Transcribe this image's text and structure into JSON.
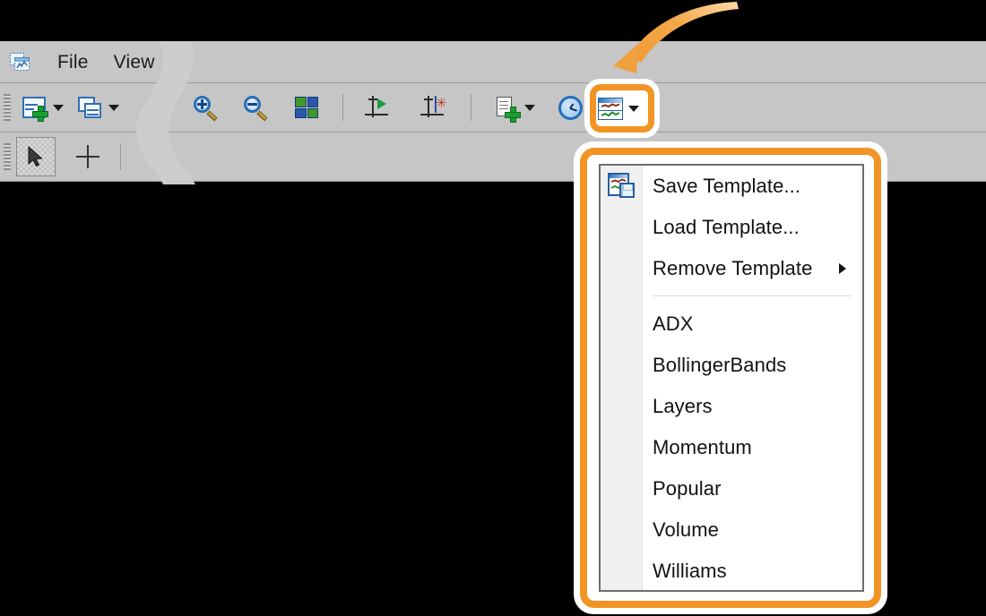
{
  "app": {
    "icon": "chart-window-icon",
    "menubar": [
      {
        "label": "File",
        "name": "menu-file"
      },
      {
        "label": "View",
        "name": "menu-view"
      }
    ]
  },
  "toolbar_row1": {
    "buttons": [
      {
        "name": "add-chart-button",
        "icon": "add-chart-icon",
        "has_dropdown": true
      },
      {
        "name": "arrange-charts-button",
        "icon": "arrange-charts-icon",
        "has_dropdown": true
      },
      {
        "name": "zoom-in-button",
        "icon": "zoom-in-icon",
        "has_dropdown": false
      },
      {
        "name": "zoom-out-button",
        "icon": "zoom-out-icon",
        "has_dropdown": false
      },
      {
        "name": "tile-windows-button",
        "icon": "tile-windows-icon",
        "has_dropdown": false
      },
      {
        "name": "axis-forward-button",
        "icon": "axis-play-icon",
        "has_dropdown": false
      },
      {
        "name": "axis-marker-button",
        "icon": "axis-marker-icon",
        "has_dropdown": false
      },
      {
        "name": "add-document-button",
        "icon": "document-plus-icon",
        "has_dropdown": true
      },
      {
        "name": "time-interval-button",
        "icon": "clock-icon",
        "has_dropdown": true
      },
      {
        "name": "template-button",
        "icon": "chart-template-icon",
        "has_dropdown": true,
        "highlighted": true
      }
    ]
  },
  "toolbar_row2": {
    "buttons": [
      {
        "name": "select-tool-button",
        "icon": "arrow-cursor-icon",
        "pressed": true
      },
      {
        "name": "crosshair-tool-button",
        "icon": "crosshair-icon",
        "pressed": false
      }
    ]
  },
  "dropdown_menu": {
    "name": "template-dropdown-menu",
    "items": [
      {
        "label": "Save Template...",
        "name": "menu-item-save-template",
        "icon": "save-template-icon",
        "submenu": false
      },
      {
        "label": "Load Template...",
        "name": "menu-item-load-template",
        "icon": null,
        "submenu": false
      },
      {
        "label": "Remove Template",
        "name": "menu-item-remove-template",
        "icon": null,
        "submenu": true
      },
      {
        "separator": true
      },
      {
        "label": "ADX",
        "name": "menu-item-adx",
        "icon": null,
        "submenu": false
      },
      {
        "label": "BollingerBands",
        "name": "menu-item-bollingerbands",
        "icon": null,
        "submenu": false
      },
      {
        "label": "Layers",
        "name": "menu-item-layers",
        "icon": null,
        "submenu": false
      },
      {
        "label": "Momentum",
        "name": "menu-item-momentum",
        "icon": null,
        "submenu": false
      },
      {
        "label": "Popular",
        "name": "menu-item-popular",
        "icon": null,
        "submenu": false
      },
      {
        "label": "Volume",
        "name": "menu-item-volume",
        "icon": null,
        "submenu": false
      },
      {
        "label": "Williams",
        "name": "menu-item-williams",
        "icon": null,
        "submenu": false
      }
    ]
  },
  "annotations": {
    "arrow": {
      "name": "callout-arrow",
      "color": "#f2a04a",
      "points_to": "template-button"
    },
    "highlight_color": "#f29423"
  },
  "colors": {
    "toolbar_bg": "#c6c6c6",
    "toolbar_border": "#9a9a9a",
    "page_bg": "#000000",
    "menu_bg": "#ffffff",
    "menu_gutter": "#f0f0f0",
    "menu_border": "#6d6d6d",
    "accent_orange": "#f29423",
    "tear_band": "#cdcdcd"
  }
}
